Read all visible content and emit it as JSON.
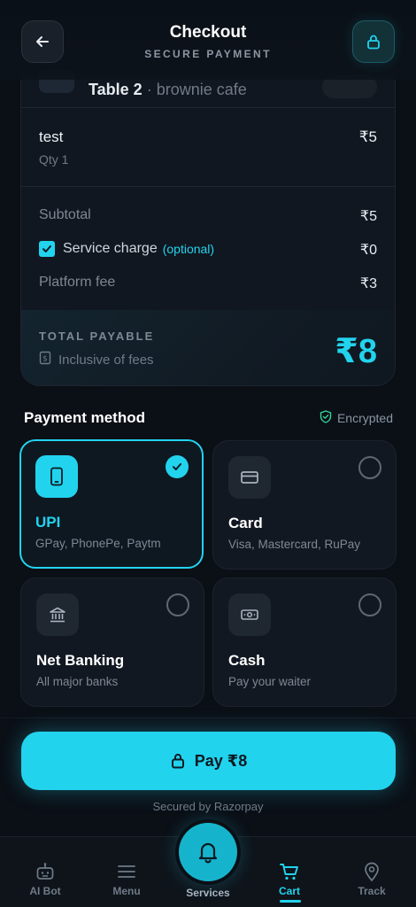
{
  "header": {
    "title": "Checkout",
    "subtitle": "SECURE PAYMENT"
  },
  "order": {
    "table_name": "Table 2",
    "separator": " · ",
    "restaurant": "brownie cafe",
    "item": {
      "name": "test",
      "qty": "Qty 1",
      "price": "₹5"
    },
    "subtotal_label": "Subtotal",
    "subtotal_value": "₹5",
    "service_label": "Service charge",
    "service_optional": "(optional)",
    "service_value": "₹0",
    "service_checked": true,
    "platform_label": "Platform fee",
    "platform_value": "₹3",
    "total_label": "TOTAL PAYABLE",
    "total_note": "Inclusive of fees",
    "total_value": "₹8"
  },
  "payment": {
    "title": "Payment method",
    "encrypted": "Encrypted",
    "selected": "upi",
    "methods": [
      {
        "id": "upi",
        "name": "UPI",
        "desc": "GPay, PhonePe, Paytm",
        "icon": "phone-icon"
      },
      {
        "id": "card",
        "name": "Card",
        "desc": "Visa, Mastercard, RuPay",
        "icon": "card-icon"
      },
      {
        "id": "netbanking",
        "name": "Net Banking",
        "desc": "All major banks",
        "icon": "bank-icon"
      },
      {
        "id": "cash",
        "name": "Cash",
        "desc": "Pay your waiter",
        "icon": "cash-icon"
      }
    ]
  },
  "pay": {
    "button_label": "Pay ₹8",
    "secured_by": "Secured by Razorpay"
  },
  "nav": {
    "items": [
      {
        "label": "AI Bot",
        "icon": "robot-icon"
      },
      {
        "label": "Menu",
        "icon": "menu-icon"
      },
      {
        "label": "Services",
        "icon": "bell-icon"
      },
      {
        "label": "Cart",
        "icon": "cart-icon",
        "active": true
      },
      {
        "label": "Track",
        "icon": "location-pin-icon"
      }
    ]
  },
  "colors": {
    "accent": "#22d3ee",
    "background": "#0b0f16",
    "card": "#111720"
  }
}
